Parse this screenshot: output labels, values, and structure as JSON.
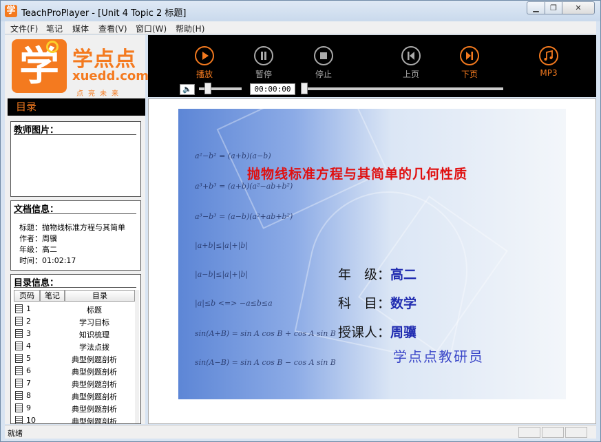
{
  "window": {
    "title": "TeachProPlayer - [Unit 4 Topic 2 标题]",
    "app_icon_glyph": "学"
  },
  "menu": [
    "文件(F)",
    "笔记",
    "媒体",
    "查看(V)",
    "窗口(W)",
    "帮助(H)"
  ],
  "logo": {
    "mark": "学",
    "name": "学点点",
    "domain": "xuedd.com",
    "tagline": "点亮未来"
  },
  "sidebar": {
    "toc_header": "目录",
    "teacher_title": "教师图片：",
    "doc_title": "文档信息：",
    "doc_info": [
      "标题：抛物线标准方程与其简单",
      "作者：周骥",
      "年级：高二",
      "时间：01:02:17"
    ],
    "toc_title": "目录信息：",
    "toc_columns": [
      "页码",
      "笔记",
      "目录"
    ],
    "toc_rows": [
      {
        "page": "1",
        "title": "标题"
      },
      {
        "page": "2",
        "title": "学习目标"
      },
      {
        "page": "3",
        "title": "知识梳理"
      },
      {
        "page": "4",
        "title": "学法点拨"
      },
      {
        "page": "5",
        "title": "典型例题剖析"
      },
      {
        "page": "6",
        "title": "典型例题剖析"
      },
      {
        "page": "7",
        "title": "典型例题剖析"
      },
      {
        "page": "8",
        "title": "典型例题剖析"
      },
      {
        "page": "9",
        "title": "典型例题剖析"
      },
      {
        "page": "10",
        "title": "典型例题剖析"
      }
    ]
  },
  "player": {
    "buttons": [
      {
        "label": "播放",
        "icon": "play-icon"
      },
      {
        "label": "暂停",
        "icon": "pause-icon"
      },
      {
        "label": "停止",
        "icon": "stop-icon"
      },
      {
        "label": "上页",
        "icon": "prev-page-icon"
      },
      {
        "label": "下页",
        "icon": "next-page-icon"
      },
      {
        "label": "MP3",
        "icon": "music-note-icon"
      }
    ],
    "volume_icon_glyph": "🔈",
    "time": "00:00:00",
    "volume_level": 0.15,
    "seek_progress": 0.0
  },
  "slide": {
    "formulas": [
      "a²−b² = (a+b)(a−b)",
      "a³+b³ = (a+b)(a²−ab+b²)",
      "a³−b³ = (a−b)(a²+ab+b²)",
      "|a+b|≤|a|+|b|",
      "|a−b|≤|a|+|b|",
      "|a|≤b <=> −a≤b≤a",
      "sin(A+B) = sin A cos B + cos A sin B",
      "sin(A−B) = sin A cos B − cos A sin B"
    ],
    "title": "抛物线标准方程与其简单的几何性质",
    "grade_label": "年　级：",
    "grade": "高二",
    "subject_label": "科　目：",
    "subject": "数学",
    "teacher_label": "授课人：",
    "teacher": "周骥",
    "team": "学点点教研员"
  },
  "status": {
    "text": "就绪"
  }
}
